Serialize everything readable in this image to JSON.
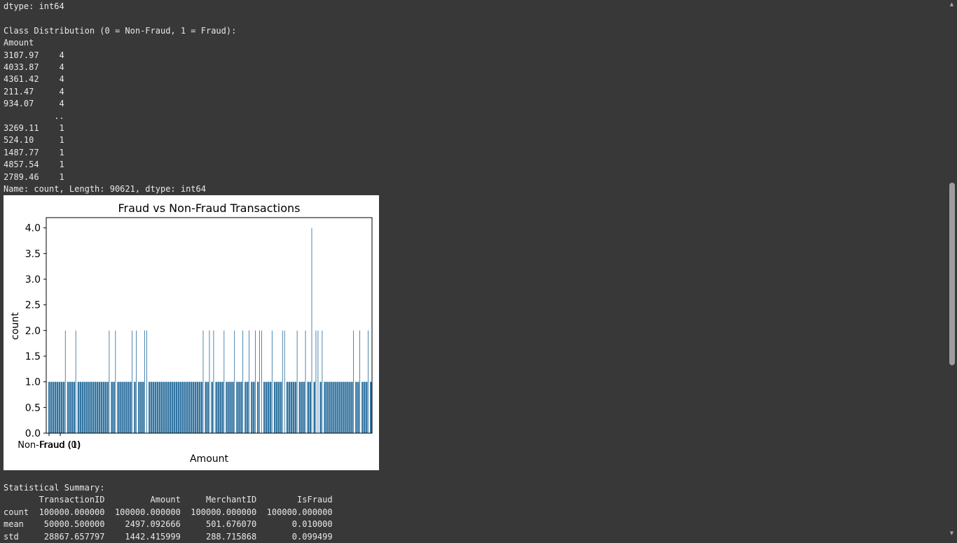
{
  "output_top": "dtype: int64\n\nClass Distribution (0 = Non-Fraud, 1 = Fraud):\nAmount\n3107.97    4\n4033.87    4\n4361.42    4\n211.47     4\n934.07     4\n          ..\n3269.11    1\n524.10     1\n1487.77    1\n4857.54    1\n2789.46    1\nName: count, Length: 90621, dtype: int64",
  "output_bottom": "Statistical Summary:\n       TransactionID         Amount     MerchantID        IsFraud\ncount  100000.000000  100000.000000  100000.000000  100000.000000\nmean    50000.500000    2497.092666     501.676070       0.010000\nstd     28867.657797    1442.415999     288.715868       0.099499",
  "scrollbar": {
    "up_icon": "▲",
    "down_icon": "▼",
    "position": 0.34
  },
  "chart_data": {
    "type": "bar",
    "title": "Fraud vs Non-Fraud Transactions",
    "xlabel": "Amount",
    "ylabel": "count",
    "ylim": [
      0,
      4.2
    ],
    "yticks": [
      "0.0",
      "0.5",
      "1.0",
      "1.5",
      "2.0",
      "2.5",
      "3.0",
      "3.5",
      "4.0"
    ],
    "xtick_labels": [
      "Non-Fraud (0)",
      "Fraud (1)"
    ],
    "bar_color": "#3274a1",
    "grid": false,
    "bar_count": 155,
    "peaks": [
      {
        "index": 126,
        "value": 4
      },
      {
        "index": 8,
        "value": 2
      },
      {
        "index": 13,
        "value": 2
      },
      {
        "index": 29,
        "value": 2
      },
      {
        "index": 32,
        "value": 2
      },
      {
        "index": 40,
        "value": 2
      },
      {
        "index": 42,
        "value": 2
      },
      {
        "index": 46,
        "value": 2
      },
      {
        "index": 47,
        "value": 2
      },
      {
        "index": 74,
        "value": 2
      },
      {
        "index": 77,
        "value": 2
      },
      {
        "index": 79,
        "value": 2
      },
      {
        "index": 84,
        "value": 2
      },
      {
        "index": 89,
        "value": 2
      },
      {
        "index": 93,
        "value": 2
      },
      {
        "index": 96,
        "value": 2
      },
      {
        "index": 99,
        "value": 2
      },
      {
        "index": 101,
        "value": 2
      },
      {
        "index": 102,
        "value": 2
      },
      {
        "index": 107,
        "value": 2
      },
      {
        "index": 112,
        "value": 2
      },
      {
        "index": 113,
        "value": 2
      },
      {
        "index": 119,
        "value": 2
      },
      {
        "index": 123,
        "value": 2
      },
      {
        "index": 128,
        "value": 2
      },
      {
        "index": 129,
        "value": 2
      },
      {
        "index": 131,
        "value": 2
      },
      {
        "index": 146,
        "value": 2
      },
      {
        "index": 149,
        "value": 2
      },
      {
        "index": 153,
        "value": 2
      }
    ],
    "default_value": 1
  }
}
